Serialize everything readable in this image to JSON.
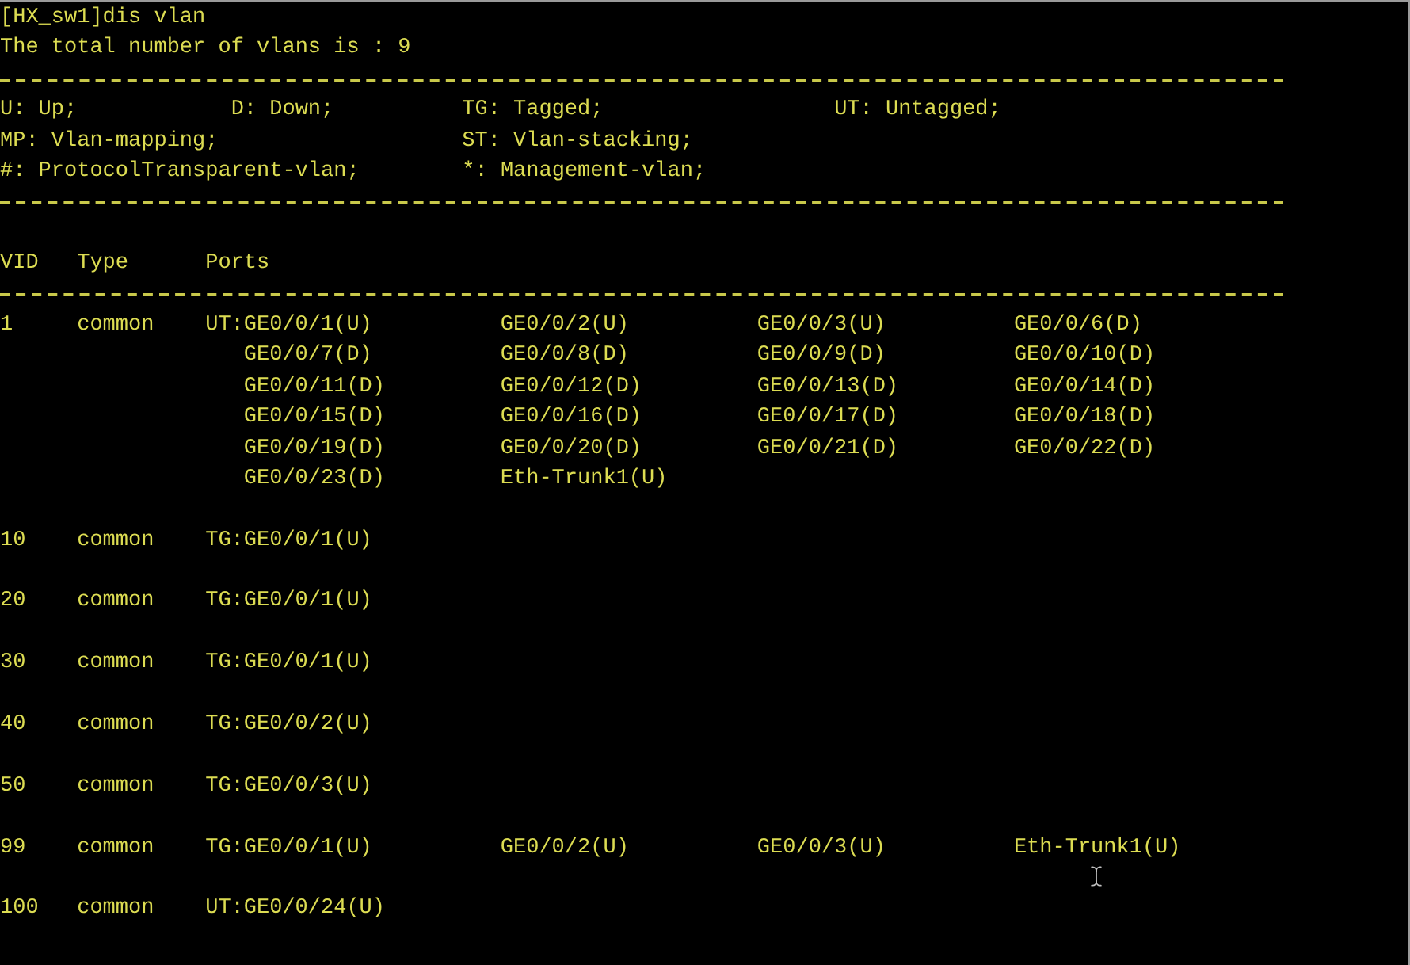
{
  "command_line": "[HX_sw1]dis vlan",
  "summary": "The total number of vlans is : 9",
  "legend": [
    [
      "U: Up;",
      "D: Down;",
      "TG: Tagged;",
      "UT: Untagged;"
    ],
    [
      "MP: Vlan-mapping;",
      "ST: Vlan-stacking;"
    ],
    [
      "#: ProtocolTransparent-vlan;",
      "*: Management-vlan;"
    ]
  ],
  "table": {
    "columns": [
      "VID",
      "Type",
      "Ports"
    ],
    "rows": [
      {
        "vid": "1",
        "type": "common",
        "tag": "UT:",
        "ports": [
          "GE0/0/1(U)",
          "GE0/0/2(U)",
          "GE0/0/3(U)",
          "GE0/0/6(D)",
          "GE0/0/7(D)",
          "GE0/0/8(D)",
          "GE0/0/9(D)",
          "GE0/0/10(D)",
          "GE0/0/11(D)",
          "GE0/0/12(D)",
          "GE0/0/13(D)",
          "GE0/0/14(D)",
          "GE0/0/15(D)",
          "GE0/0/16(D)",
          "GE0/0/17(D)",
          "GE0/0/18(D)",
          "GE0/0/19(D)",
          "GE0/0/20(D)",
          "GE0/0/21(D)",
          "GE0/0/22(D)",
          "GE0/0/23(D)",
          "Eth-Trunk1(U)"
        ]
      },
      {
        "vid": "10",
        "type": "common",
        "tag": "TG:",
        "ports": [
          "GE0/0/1(U)"
        ]
      },
      {
        "vid": "20",
        "type": "common",
        "tag": "TG:",
        "ports": [
          "GE0/0/1(U)"
        ]
      },
      {
        "vid": "30",
        "type": "common",
        "tag": "TG:",
        "ports": [
          "GE0/0/1(U)"
        ]
      },
      {
        "vid": "40",
        "type": "common",
        "tag": "TG:",
        "ports": [
          "GE0/0/2(U)"
        ]
      },
      {
        "vid": "50",
        "type": "common",
        "tag": "TG:",
        "ports": [
          "GE0/0/3(U)"
        ]
      },
      {
        "vid": "99",
        "type": "common",
        "tag": "TG:",
        "ports": [
          "GE0/0/1(U)",
          "GE0/0/2(U)",
          "GE0/0/3(U)",
          "Eth-Trunk1(U)"
        ]
      },
      {
        "vid": "100",
        "type": "common",
        "tag": "UT:",
        "ports": [
          "GE0/0/24(U)"
        ]
      }
    ]
  }
}
